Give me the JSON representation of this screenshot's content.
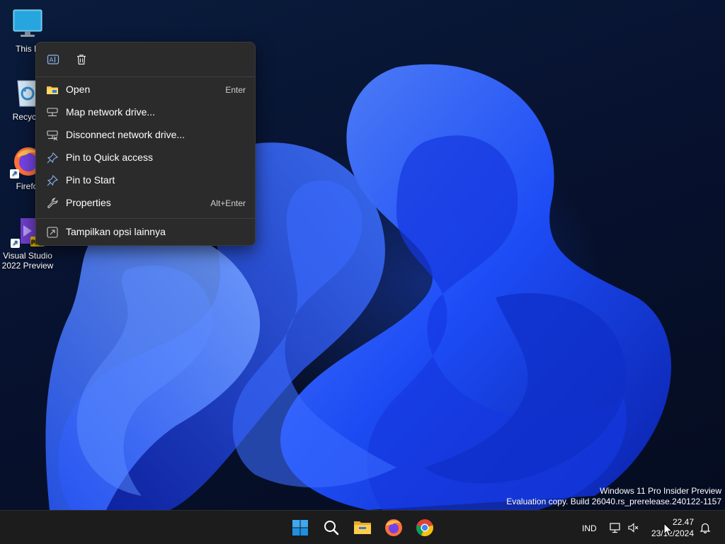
{
  "desktop_icons": [
    {
      "label": "This P",
      "icon": "monitor-icon"
    },
    {
      "label": "Recycle",
      "icon": "recycle-bin-icon"
    },
    {
      "label": "Firefo",
      "icon": "firefox-icon"
    },
    {
      "label_line1": "Visual Studio",
      "label_line2": "2022 Preview",
      "icon": "visual-studio-icon",
      "badge": "PRE"
    }
  ],
  "context_menu": {
    "top_actions": [
      {
        "icon": "rename-icon"
      },
      {
        "icon": "delete-icon"
      }
    ],
    "items": [
      {
        "label": "Open",
        "shortcut": "Enter",
        "icon": "folder-icon"
      },
      {
        "label": "Map network drive...",
        "icon": "map-drive-icon"
      },
      {
        "label": "Disconnect network drive...",
        "icon": "disconnect-drive-icon"
      },
      {
        "label": "Pin to Quick access",
        "icon": "pin-icon"
      },
      {
        "label": "Pin to Start",
        "icon": "pin-icon"
      },
      {
        "label": "Properties",
        "shortcut": "Alt+Enter",
        "icon": "wrench-icon"
      },
      {
        "label": "Tampilkan opsi lainnya",
        "icon": "more-options-icon"
      }
    ]
  },
  "watermark": {
    "line1": "Windows 11 Pro Insider Preview",
    "line2": "Evaluation copy. Build 26040.rs_prerelease.240122-1157"
  },
  "taskbar": {
    "apps": [
      "windows-start-icon",
      "search-icon",
      "file-explorer-icon",
      "firefox-icon",
      "chrome-icon"
    ],
    "language": "IND",
    "time": "22.47",
    "date": "23/12/2024"
  },
  "colors": {
    "menu_bg": "#2b2b2b",
    "taskbar_bg": "#1c1c1c",
    "accent": "#0078d4"
  }
}
